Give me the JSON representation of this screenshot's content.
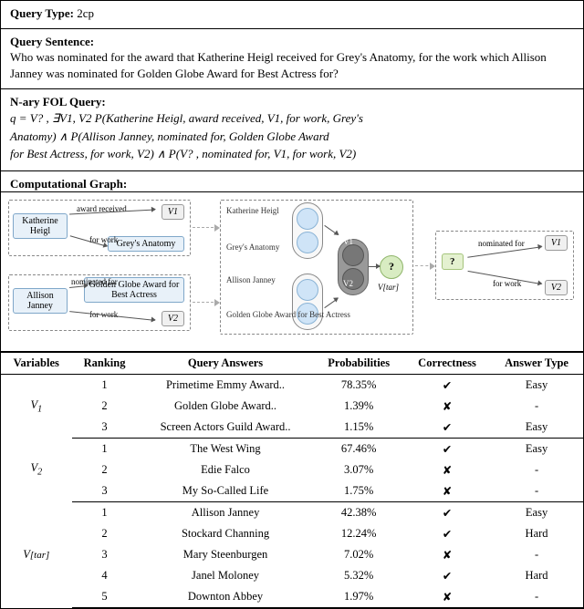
{
  "query_type": {
    "label": "Query Type:",
    "value": "2cp"
  },
  "query_sentence": {
    "label": "Query Sentence:",
    "text": "Who was nominated for the award that Katherine Heigl received for Grey's Anatomy, for the work which Allison Janney was nominated for Golden Globe Award for Best Actress for?"
  },
  "fol": {
    "label": "N-ary FOL Query:",
    "line1": "q = V? , ∃V1, V2  P(Katherine Heigl, award received, V1, for work, Grey's",
    "line2": "Anatomy) ∧ P(Allison Janney, nominated for, Golden Globe Award",
    "line3": "for Best Actress, for work, V2) ∧ P(V? , nominated for, V1, for work, V2)"
  },
  "graph": {
    "label": "Computational Graph:",
    "entities": {
      "kh": "Katherine Heigl",
      "ga": "Grey's Anatomy",
      "aj": "Allison Janney",
      "gg": "Golden Globe Award for Best Actress"
    },
    "rels": {
      "award_received": "award received",
      "for_work": "for work",
      "nominated_for": "nominated for"
    },
    "vars": {
      "v1": "V1",
      "v2": "V2",
      "q": "?",
      "vtar": "V[tar]"
    },
    "emb_labels": {
      "kh": "Katherine Heigl",
      "ga": "Grey's Anatomy",
      "aj": "Allison Janney",
      "gg": "Golden Globe Award for Best Actress",
      "v1": "V1",
      "v2": "V2"
    }
  },
  "table": {
    "headers": {
      "variables": "Variables",
      "ranking": "Ranking",
      "answers": "Query Answers",
      "probs": "Probabilities",
      "correct": "Correctness",
      "atype": "Answer Type"
    },
    "groups": [
      {
        "var": "V1",
        "rows": [
          {
            "rank": "1",
            "answer": "Primetime Emmy Award..",
            "prob": "78.35%",
            "correct": "✔",
            "atype": "Easy"
          },
          {
            "rank": "2",
            "answer": "Golden Globe Award..",
            "prob": "1.39%",
            "correct": "✘",
            "atype": "-"
          },
          {
            "rank": "3",
            "answer": "Screen Actors Guild Award..",
            "prob": "1.15%",
            "correct": "✔",
            "atype": "Easy"
          }
        ]
      },
      {
        "var": "V2",
        "rows": [
          {
            "rank": "1",
            "answer": "The West Wing",
            "prob": "67.46%",
            "correct": "✔",
            "atype": "Easy"
          },
          {
            "rank": "2",
            "answer": "Edie Falco",
            "prob": "3.07%",
            "correct": "✘",
            "atype": "-"
          },
          {
            "rank": "3",
            "answer": "My So-Called Life",
            "prob": "1.75%",
            "correct": "✘",
            "atype": "-"
          }
        ]
      },
      {
        "var": "V[tar]",
        "rows": [
          {
            "rank": "1",
            "answer": "Allison Janney",
            "prob": "42.38%",
            "correct": "✔",
            "atype": "Easy"
          },
          {
            "rank": "2",
            "answer": "Stockard Channing",
            "prob": "12.24%",
            "correct": "✔",
            "atype": "Hard"
          },
          {
            "rank": "3",
            "answer": "Mary Steenburgen",
            "prob": "7.02%",
            "correct": "✘",
            "atype": "-"
          },
          {
            "rank": "4",
            "answer": "Janel Moloney",
            "prob": "5.32%",
            "correct": "✔",
            "atype": "Hard"
          },
          {
            "rank": "5",
            "answer": "Downton Abbey",
            "prob": "1.97%",
            "correct": "✘",
            "atype": "-"
          }
        ]
      }
    ]
  }
}
